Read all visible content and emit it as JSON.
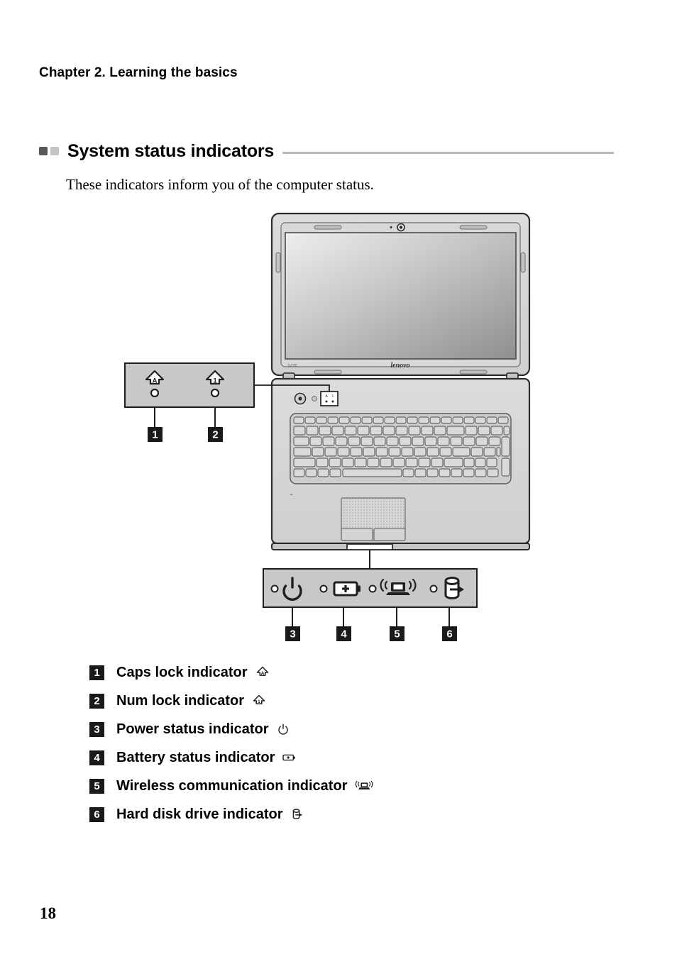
{
  "header": {
    "chapter": "Chapter 2. Learning the basics"
  },
  "section": {
    "title": "System status indicators",
    "intro": "These indicators inform you of the computer status.",
    "bullet_dark_color": "#575757",
    "bullet_light_color": "#c3c3c3",
    "rule_color": "#b9b9b9"
  },
  "figure": {
    "laptop_brand": "lenovo",
    "model_mark": "G770",
    "panel_fill": "#c8c8c8",
    "body_fill": "#d2d2d2",
    "outline_color": "#2b2b2b",
    "top_panel": {
      "callouts": [
        "1",
        "2"
      ],
      "indicators": [
        {
          "name": "caps-lock",
          "glyph": "A"
        },
        {
          "name": "num-lock",
          "glyph": "1"
        }
      ]
    },
    "bottom_panel": {
      "callouts": [
        "3",
        "4",
        "5",
        "6"
      ],
      "indicators": [
        {
          "name": "power-status"
        },
        {
          "name": "battery-status"
        },
        {
          "name": "wireless-communication"
        },
        {
          "name": "hard-disk-drive"
        }
      ]
    }
  },
  "legend": {
    "items": [
      {
        "number": "1",
        "label": "Caps lock indicator",
        "icon": "caps-lock-icon"
      },
      {
        "number": "2",
        "label": "Num lock indicator",
        "icon": "num-lock-icon"
      },
      {
        "number": "3",
        "label": "Power status indicator",
        "icon": "power-icon"
      },
      {
        "number": "4",
        "label": "Battery status indicator",
        "icon": "battery-icon"
      },
      {
        "number": "5",
        "label": "Wireless communication indicator",
        "icon": "wireless-icon"
      },
      {
        "number": "6",
        "label": "Hard disk drive indicator",
        "icon": "hard-disk-icon"
      }
    ]
  },
  "footer": {
    "page_number": "18"
  }
}
